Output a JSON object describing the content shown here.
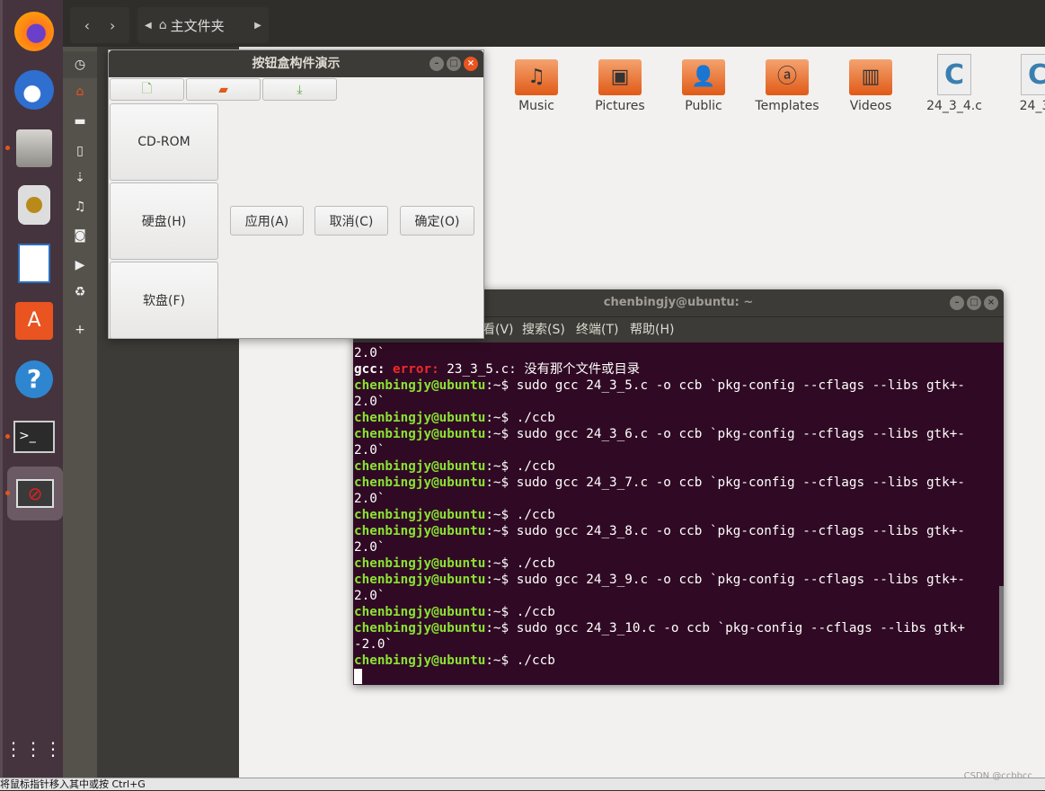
{
  "launcher": {
    "items": [
      "firefox",
      "thunderbird",
      "files",
      "rhythmbox",
      "libreoffice-writer",
      "software-center",
      "help",
      "terminal",
      "app-running"
    ],
    "running": [
      2,
      7,
      8
    ]
  },
  "topbar": {
    "location": "主文件夹"
  },
  "sidebar_icons": [
    "clock-icon",
    "home-icon",
    "folder-icon",
    "document-icon",
    "download-icon",
    "music-icon",
    "camera-icon",
    "video-icon",
    "trash-icon",
    "plus-icon"
  ],
  "files": [
    {
      "name": "Music",
      "type": "music"
    },
    {
      "name": "Pictures",
      "type": "pictures"
    },
    {
      "name": "Public",
      "type": "public"
    },
    {
      "name": "Templates",
      "type": "templates"
    },
    {
      "name": "Videos",
      "type": "videos"
    },
    {
      "name": "24_3_4.c",
      "type": "c"
    },
    {
      "name": "24_3_",
      "type": "c"
    }
  ],
  "dialog": {
    "title": "按钮盒构件演示",
    "left_buttons": [
      "CD-ROM",
      "硬盘(H)",
      "软盘(F)"
    ],
    "right_buttons": [
      "应用(A)",
      "取消(C)",
      "确定(O)"
    ],
    "toolbar": [
      "new-file-icon",
      "open-folder-icon",
      "save-download-icon"
    ]
  },
  "terminal": {
    "title": "chenbingjy@ubuntu: ~",
    "menu": [
      "查看(V)",
      "搜索(S)",
      "终端(T)",
      "帮助(H)"
    ],
    "lines": [
      [
        [
          "",
          "2.0`"
        ]
      ],
      [
        [
          "bw",
          "gcc:"
        ],
        [
          "",
          " "
        ],
        [
          "er",
          "error:"
        ],
        [
          "",
          " 23_3_5.c: 没有那个文件或目录"
        ]
      ],
      [
        [
          "pr",
          "chenbingjy@ubuntu"
        ],
        [
          "",
          ":~$ sudo gcc 24_3_5.c -o ccb `pkg-config --cflags --libs gtk+-"
        ]
      ],
      [
        [
          "",
          "2.0`"
        ]
      ],
      [
        [
          "pr",
          "chenbingjy@ubuntu"
        ],
        [
          "",
          ":~$ ./ccb"
        ]
      ],
      [
        [
          "pr",
          "chenbingjy@ubuntu"
        ],
        [
          "",
          ":~$ sudo gcc 24_3_6.c -o ccb `pkg-config --cflags --libs gtk+-"
        ]
      ],
      [
        [
          "",
          "2.0`"
        ]
      ],
      [
        [
          "pr",
          "chenbingjy@ubuntu"
        ],
        [
          "",
          ":~$ ./ccb"
        ]
      ],
      [
        [
          "pr",
          "chenbingjy@ubuntu"
        ],
        [
          "",
          ":~$ sudo gcc 24_3_7.c -o ccb `pkg-config --cflags --libs gtk+-"
        ]
      ],
      [
        [
          "",
          "2.0`"
        ]
      ],
      [
        [
          "pr",
          "chenbingjy@ubuntu"
        ],
        [
          "",
          ":~$ ./ccb"
        ]
      ],
      [
        [
          "pr",
          "chenbingjy@ubuntu"
        ],
        [
          "",
          ":~$ sudo gcc 24_3_8.c -o ccb `pkg-config --cflags --libs gtk+-"
        ]
      ],
      [
        [
          "",
          "2.0`"
        ]
      ],
      [
        [
          "pr",
          "chenbingjy@ubuntu"
        ],
        [
          "",
          ":~$ ./ccb"
        ]
      ],
      [
        [
          "pr",
          "chenbingjy@ubuntu"
        ],
        [
          "",
          ":~$ sudo gcc 24_3_9.c -o ccb `pkg-config --cflags --libs gtk+-"
        ]
      ],
      [
        [
          "",
          "2.0`"
        ]
      ],
      [
        [
          "pr",
          "chenbingjy@ubuntu"
        ],
        [
          "",
          ":~$ ./ccb"
        ]
      ],
      [
        [
          "pr",
          "chenbingjy@ubuntu"
        ],
        [
          "",
          ":~$ sudo gcc 24_3_10.c -o ccb `pkg-config --cflags --libs gtk+"
        ]
      ],
      [
        [
          "",
          "-2.0`"
        ]
      ],
      [
        [
          "pr",
          "chenbingjy@ubuntu"
        ],
        [
          "",
          ":~$ ./ccb"
        ]
      ]
    ]
  },
  "statusbar": {
    "hint": "将鼠标指针移入其中或按 Ctrl+G"
  },
  "watermark": "CSDN @ccbbcc",
  "colors": {
    "terminal_bg": "#300a24",
    "prompt": "#8ae234",
    "error": "#ef2929",
    "accent": "#e95420"
  }
}
